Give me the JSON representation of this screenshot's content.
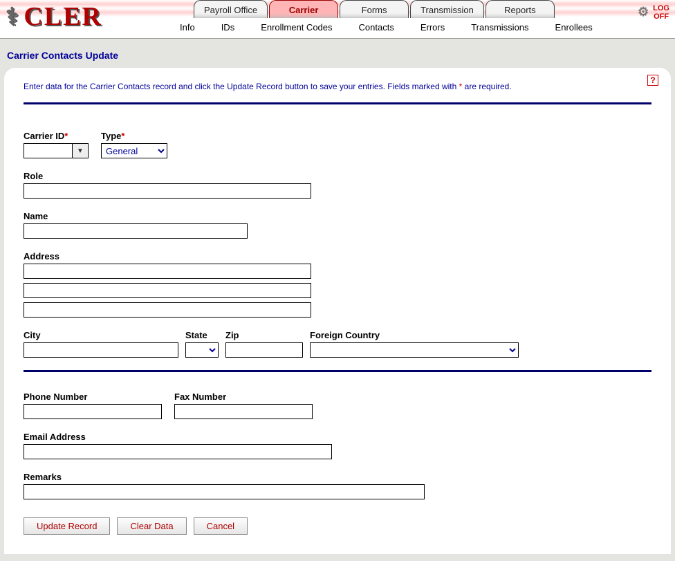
{
  "brand": "CLER",
  "logoff_label": "LOG\nOFF",
  "main_tabs": [
    {
      "label": "Payroll Office",
      "active": false
    },
    {
      "label": "Carrier",
      "active": true
    },
    {
      "label": "Forms",
      "active": false
    },
    {
      "label": "Transmission",
      "active": false
    },
    {
      "label": "Reports",
      "active": false
    }
  ],
  "sub_tabs": [
    "Info",
    "IDs",
    "Enrollment Codes",
    "Contacts",
    "Errors",
    "Transmissions",
    "Enrollees"
  ],
  "page_title": "Carrier Contacts Update",
  "instructions_pre": "Enter data for the Carrier Contacts record and click the Update Record button to save your entries.  Fields marked with ",
  "instructions_mark": "*",
  "instructions_post": " are required.",
  "labels": {
    "carrier_id": "Carrier ID",
    "type": "Type",
    "role": "Role",
    "name": "Name",
    "address": "Address",
    "city": "City",
    "state": "State",
    "zip": "Zip",
    "foreign_country": "Foreign Country",
    "phone": "Phone Number",
    "fax": "Fax Number",
    "email": "Email Address",
    "remarks": "Remarks"
  },
  "values": {
    "carrier_id": "",
    "type_selected": "General",
    "role": "",
    "name": "",
    "address1": "",
    "address2": "",
    "address3": "",
    "city": "",
    "state": "",
    "zip": "",
    "foreign_country": "",
    "phone": "",
    "fax": "",
    "email": "",
    "remarks": ""
  },
  "buttons": {
    "update": "Update Record",
    "clear": "Clear Data",
    "cancel": "Cancel"
  }
}
